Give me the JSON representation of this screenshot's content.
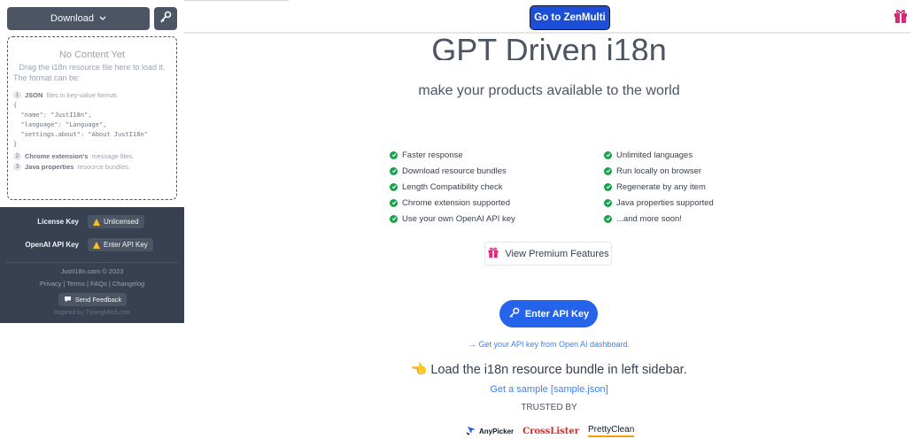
{
  "sidebar": {
    "download_label": "Download",
    "dropzone": {
      "title": "No Content Yet",
      "line1": "Drag the i18n resource file here to load it.",
      "line2": "The format can be:",
      "item1_num": "1",
      "item1_bold": "JSON",
      "item1_rest": "files in key-value format.",
      "code": "{\n  \"name\": \"JustI18n\",\n  \"language\": \"Language\",\n  \"settings.about\": \"About JustI18n\"\n}",
      "item2_num": "2",
      "item2_bold": "Chrome extension's",
      "item2_rest": "message files.",
      "item3_num": "3",
      "item3_bold": "Java properties",
      "item3_rest": "resource bundles."
    },
    "license_label": "License Key",
    "license_status": "Unlicensed",
    "openai_label": "OpenAI API Key",
    "openai_action": "Enter API Key",
    "copyright": "JustI18n.com © 2023",
    "links": [
      "Privacy",
      "Terms",
      "FAQs",
      "Changelog"
    ],
    "link_sep": "|",
    "feedback_label": "Send Feedback",
    "inspired": "Inspired by TypingMind.com"
  },
  "main": {
    "zen_button": "Go to ZenMulti",
    "hero_title": "GPT Driven i18n",
    "subtitle": "make your products available to the world",
    "features_left": [
      "Faster response",
      "Download resource bundles",
      "Length Compatibility check",
      "Chrome extension supported",
      "Use your own OpenAI API key"
    ],
    "features_right": [
      "Unlimited languages",
      "Run locally on browser",
      "Regenerate by any item",
      "Java properties supported",
      "...and more soon!"
    ],
    "premium_button": "View Premium Features",
    "api_button": "Enter API Key",
    "api_link": "→ Get your API key from Open AI dashboard.",
    "load_text": "👈 Load the i18n resource bundle in left sidebar.",
    "sample_link": "Get a sample [sample.json]",
    "trusted_by": "TRUSTED BY",
    "logos": [
      "AnyPicker",
      "CrossLister",
      "PrettyClean"
    ]
  },
  "colors": {
    "sidebar_dark": "#374151",
    "button_gray": "#4b5563",
    "primary_blue": "#2563eb",
    "check_green": "#16a34a",
    "warning_yellow": "#fbbf24",
    "gift_pink": "#db2777"
  },
  "icons": {
    "download_chevron": "chevron-down-icon",
    "key": "key-icon",
    "warning": "warning-icon",
    "gift": "gift-icon",
    "check": "check-circle-icon",
    "feedback": "chat-bubble-icon"
  }
}
